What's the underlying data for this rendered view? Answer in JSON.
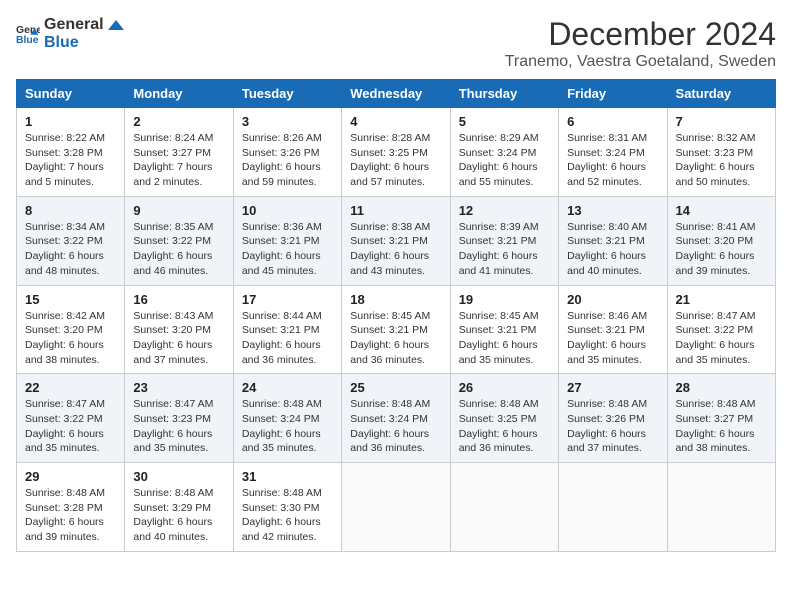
{
  "header": {
    "logo": {
      "general": "General",
      "blue": "Blue"
    },
    "title": "December 2024",
    "subtitle": "Tranemo, Vaestra Goetaland, Sweden"
  },
  "days_of_week": [
    "Sunday",
    "Monday",
    "Tuesday",
    "Wednesday",
    "Thursday",
    "Friday",
    "Saturday"
  ],
  "weeks": [
    [
      {
        "day": "1",
        "sunrise": "Sunrise: 8:22 AM",
        "sunset": "Sunset: 3:28 PM",
        "daylight": "Daylight: 7 hours and 5 minutes."
      },
      {
        "day": "2",
        "sunrise": "Sunrise: 8:24 AM",
        "sunset": "Sunset: 3:27 PM",
        "daylight": "Daylight: 7 hours and 2 minutes."
      },
      {
        "day": "3",
        "sunrise": "Sunrise: 8:26 AM",
        "sunset": "Sunset: 3:26 PM",
        "daylight": "Daylight: 6 hours and 59 minutes."
      },
      {
        "day": "4",
        "sunrise": "Sunrise: 8:28 AM",
        "sunset": "Sunset: 3:25 PM",
        "daylight": "Daylight: 6 hours and 57 minutes."
      },
      {
        "day": "5",
        "sunrise": "Sunrise: 8:29 AM",
        "sunset": "Sunset: 3:24 PM",
        "daylight": "Daylight: 6 hours and 55 minutes."
      },
      {
        "day": "6",
        "sunrise": "Sunrise: 8:31 AM",
        "sunset": "Sunset: 3:24 PM",
        "daylight": "Daylight: 6 hours and 52 minutes."
      },
      {
        "day": "7",
        "sunrise": "Sunrise: 8:32 AM",
        "sunset": "Sunset: 3:23 PM",
        "daylight": "Daylight: 6 hours and 50 minutes."
      }
    ],
    [
      {
        "day": "8",
        "sunrise": "Sunrise: 8:34 AM",
        "sunset": "Sunset: 3:22 PM",
        "daylight": "Daylight: 6 hours and 48 minutes."
      },
      {
        "day": "9",
        "sunrise": "Sunrise: 8:35 AM",
        "sunset": "Sunset: 3:22 PM",
        "daylight": "Daylight: 6 hours and 46 minutes."
      },
      {
        "day": "10",
        "sunrise": "Sunrise: 8:36 AM",
        "sunset": "Sunset: 3:21 PM",
        "daylight": "Daylight: 6 hours and 45 minutes."
      },
      {
        "day": "11",
        "sunrise": "Sunrise: 8:38 AM",
        "sunset": "Sunset: 3:21 PM",
        "daylight": "Daylight: 6 hours and 43 minutes."
      },
      {
        "day": "12",
        "sunrise": "Sunrise: 8:39 AM",
        "sunset": "Sunset: 3:21 PM",
        "daylight": "Daylight: 6 hours and 41 minutes."
      },
      {
        "day": "13",
        "sunrise": "Sunrise: 8:40 AM",
        "sunset": "Sunset: 3:21 PM",
        "daylight": "Daylight: 6 hours and 40 minutes."
      },
      {
        "day": "14",
        "sunrise": "Sunrise: 8:41 AM",
        "sunset": "Sunset: 3:20 PM",
        "daylight": "Daylight: 6 hours and 39 minutes."
      }
    ],
    [
      {
        "day": "15",
        "sunrise": "Sunrise: 8:42 AM",
        "sunset": "Sunset: 3:20 PM",
        "daylight": "Daylight: 6 hours and 38 minutes."
      },
      {
        "day": "16",
        "sunrise": "Sunrise: 8:43 AM",
        "sunset": "Sunset: 3:20 PM",
        "daylight": "Daylight: 6 hours and 37 minutes."
      },
      {
        "day": "17",
        "sunrise": "Sunrise: 8:44 AM",
        "sunset": "Sunset: 3:21 PM",
        "daylight": "Daylight: 6 hours and 36 minutes."
      },
      {
        "day": "18",
        "sunrise": "Sunrise: 8:45 AM",
        "sunset": "Sunset: 3:21 PM",
        "daylight": "Daylight: 6 hours and 36 minutes."
      },
      {
        "day": "19",
        "sunrise": "Sunrise: 8:45 AM",
        "sunset": "Sunset: 3:21 PM",
        "daylight": "Daylight: 6 hours and 35 minutes."
      },
      {
        "day": "20",
        "sunrise": "Sunrise: 8:46 AM",
        "sunset": "Sunset: 3:21 PM",
        "daylight": "Daylight: 6 hours and 35 minutes."
      },
      {
        "day": "21",
        "sunrise": "Sunrise: 8:47 AM",
        "sunset": "Sunset: 3:22 PM",
        "daylight": "Daylight: 6 hours and 35 minutes."
      }
    ],
    [
      {
        "day": "22",
        "sunrise": "Sunrise: 8:47 AM",
        "sunset": "Sunset: 3:22 PM",
        "daylight": "Daylight: 6 hours and 35 minutes."
      },
      {
        "day": "23",
        "sunrise": "Sunrise: 8:47 AM",
        "sunset": "Sunset: 3:23 PM",
        "daylight": "Daylight: 6 hours and 35 minutes."
      },
      {
        "day": "24",
        "sunrise": "Sunrise: 8:48 AM",
        "sunset": "Sunset: 3:24 PM",
        "daylight": "Daylight: 6 hours and 35 minutes."
      },
      {
        "day": "25",
        "sunrise": "Sunrise: 8:48 AM",
        "sunset": "Sunset: 3:24 PM",
        "daylight": "Daylight: 6 hours and 36 minutes."
      },
      {
        "day": "26",
        "sunrise": "Sunrise: 8:48 AM",
        "sunset": "Sunset: 3:25 PM",
        "daylight": "Daylight: 6 hours and 36 minutes."
      },
      {
        "day": "27",
        "sunrise": "Sunrise: 8:48 AM",
        "sunset": "Sunset: 3:26 PM",
        "daylight": "Daylight: 6 hours and 37 minutes."
      },
      {
        "day": "28",
        "sunrise": "Sunrise: 8:48 AM",
        "sunset": "Sunset: 3:27 PM",
        "daylight": "Daylight: 6 hours and 38 minutes."
      }
    ],
    [
      {
        "day": "29",
        "sunrise": "Sunrise: 8:48 AM",
        "sunset": "Sunset: 3:28 PM",
        "daylight": "Daylight: 6 hours and 39 minutes."
      },
      {
        "day": "30",
        "sunrise": "Sunrise: 8:48 AM",
        "sunset": "Sunset: 3:29 PM",
        "daylight": "Daylight: 6 hours and 40 minutes."
      },
      {
        "day": "31",
        "sunrise": "Sunrise: 8:48 AM",
        "sunset": "Sunset: 3:30 PM",
        "daylight": "Daylight: 6 hours and 42 minutes."
      },
      null,
      null,
      null,
      null
    ]
  ]
}
